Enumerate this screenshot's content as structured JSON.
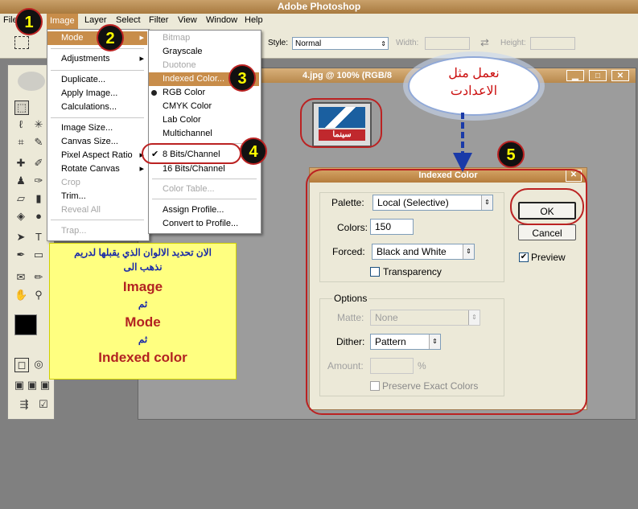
{
  "app": {
    "title": "Adobe Photoshop"
  },
  "menubar": {
    "file": "File",
    "image": "Image",
    "layer": "Layer",
    "select": "Select",
    "filter": "Filter",
    "view": "View",
    "window": "Window",
    "help": "Help"
  },
  "options": {
    "style_label": "Style:",
    "style_value": "Normal",
    "width_label": "Width:",
    "height_label": "Height:"
  },
  "document": {
    "title": "4.jpg @ 100% (RGB/8",
    "logo_text": "سينما"
  },
  "image_menu": {
    "items": [
      "Mode",
      "Adjustments",
      "Duplicate...",
      "Apply Image...",
      "Calculations...",
      "Image Size...",
      "Canvas Size...",
      "Pixel Aspect Ratio",
      "Rotate Canvas",
      "Crop",
      "Trim...",
      "Reveal All",
      "Trap..."
    ]
  },
  "mode_menu": {
    "items": [
      "Bitmap",
      "Grayscale",
      "Duotone",
      "Indexed Color...",
      "RGB Color",
      "CMYK Color",
      "Lab Color",
      "Multichannel",
      "8 Bits/Channel",
      "16 Bits/Channel",
      "Color Table...",
      "Assign Profile...",
      "Convert to Profile..."
    ]
  },
  "dialog": {
    "title": "Indexed Color",
    "palette_label": "Palette:",
    "palette_value": "Local (Selective)",
    "colors_label": "Colors:",
    "colors_value": "150",
    "forced_label": "Forced:",
    "forced_value": "Black and White",
    "transparency_label": "Transparency",
    "options_label": "Options",
    "matte_label": "Matte:",
    "matte_value": "None",
    "dither_label": "Dither:",
    "dither_value": "Pattern",
    "amount_label": "Amount:",
    "amount_unit": "%",
    "preserve_label": "Preserve Exact Colors",
    "ok_label": "OK",
    "cancel_label": "Cancel",
    "preview_label": "Preview",
    "preview_checked": true,
    "transparency_checked": false
  },
  "badges": [
    "1",
    "2",
    "3",
    "4",
    "5"
  ],
  "callout": {
    "line1": "نعمل مثل",
    "line2": "الاعدادت"
  },
  "note": {
    "line1": "الان تحديد الالوان الذي يقبلها لدريم",
    "line2": "نذهب الى",
    "line3": "Image",
    "line4": "ثم",
    "line5": "Mode",
    "line6": "ثم",
    "line7": "Indexed color"
  },
  "colors": {
    "accent": "#c88d4a",
    "badge_text": "#ffff00",
    "annotation_red": "#b22222",
    "note_text": "#b22222",
    "note_bg": "#ffff80"
  }
}
